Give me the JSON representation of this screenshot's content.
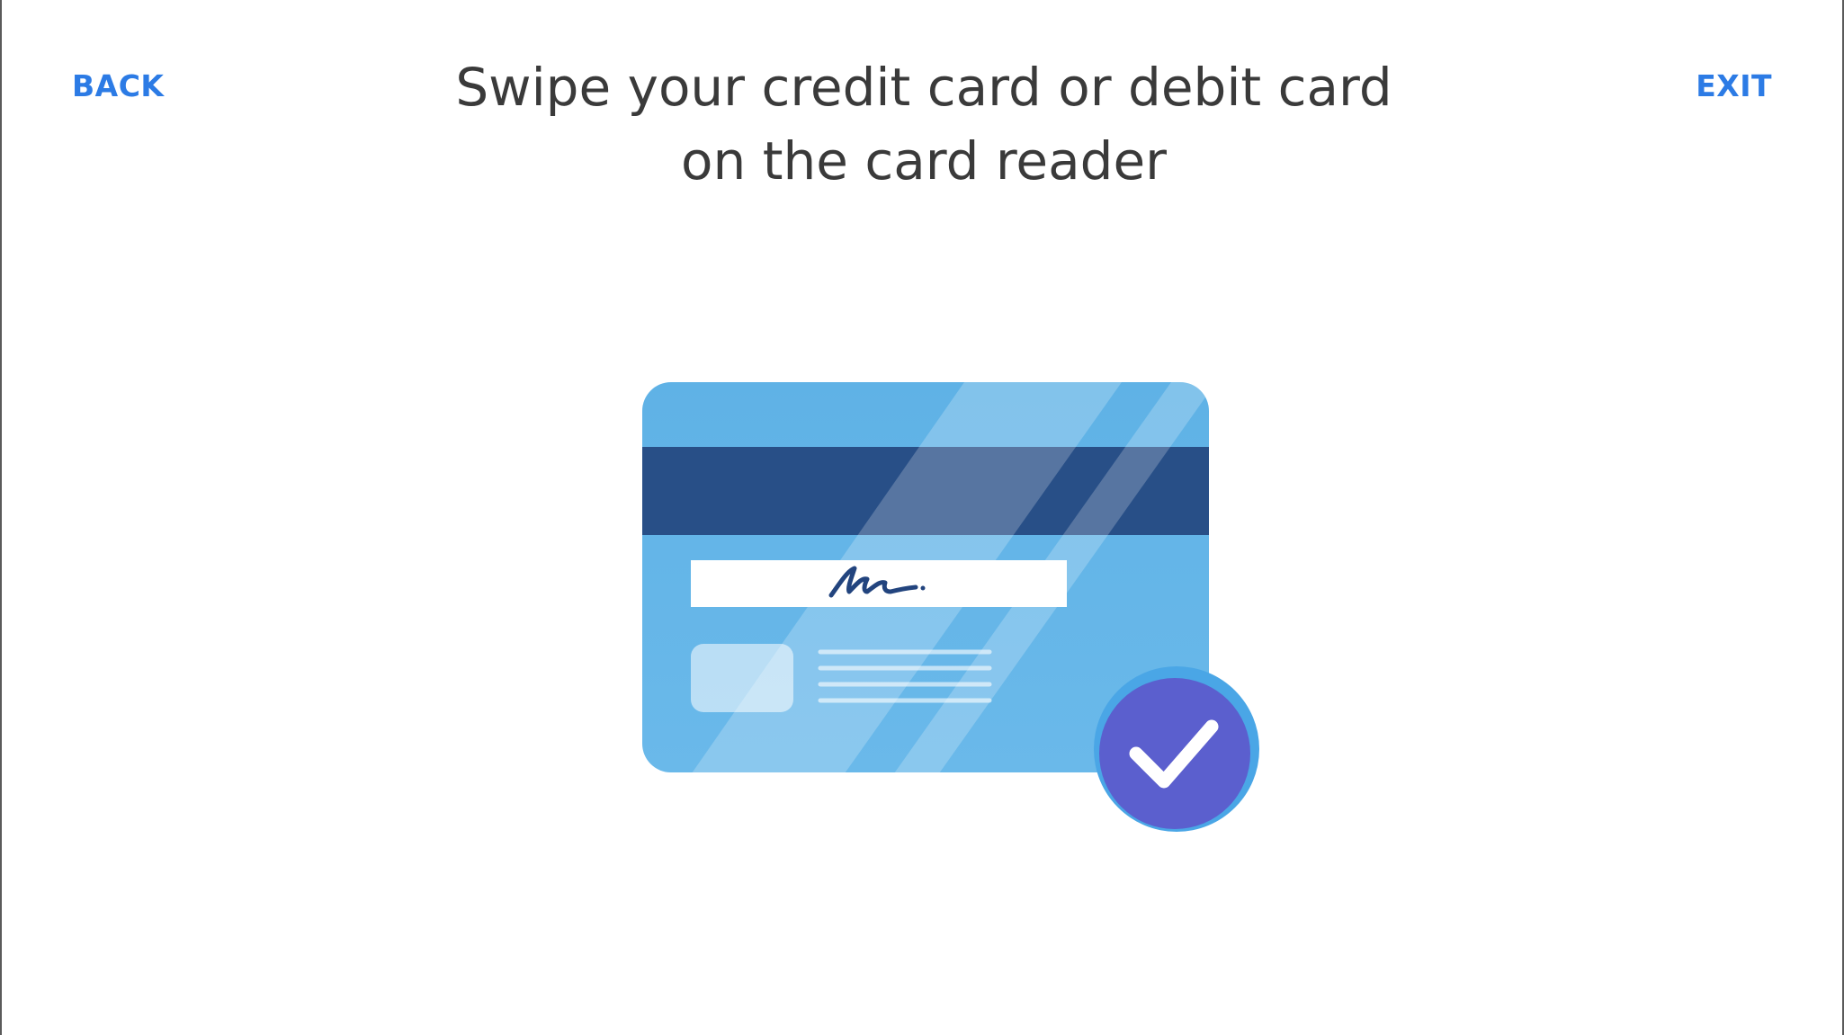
{
  "header": {
    "back_label": "BACK",
    "exit_label": "EXIT",
    "title_line1": "Swipe your credit card or debit card",
    "title_line2": "on the card reader"
  },
  "illustration": {
    "card_icon": "credit-card-back-icon",
    "check_icon": "check-circle-icon",
    "colors": {
      "card": "#62b6e7",
      "magnetic_stripe": "#284f87",
      "signature_ink": "#22447e",
      "check_badge": "#5b5fce",
      "accent": "#2c7be5"
    }
  }
}
